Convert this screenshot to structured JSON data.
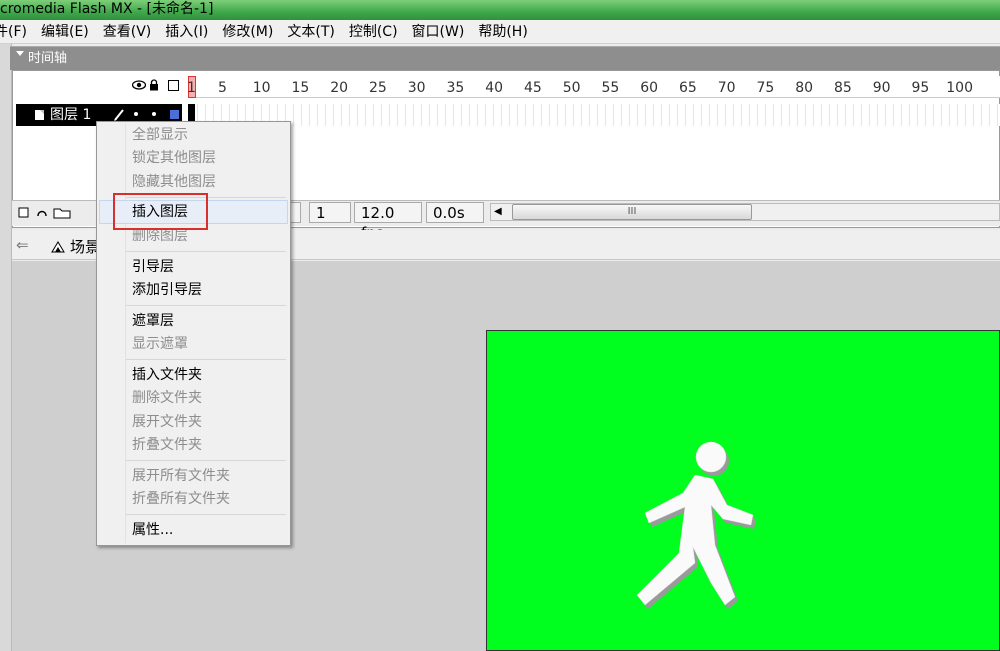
{
  "window": {
    "title": "cromedia Flash MX - [未命名-1]"
  },
  "menubar": [
    "件(F)",
    "编辑(E)",
    "查看(V)",
    "插入(I)",
    "修改(M)",
    "文本(T)",
    "控制(C)",
    "窗口(W)",
    "帮助(H)"
  ],
  "timeline": {
    "title": "时间轴",
    "ruler_ticks": [
      "1",
      "5",
      "10",
      "15",
      "20",
      "25",
      "30",
      "35",
      "40",
      "45",
      "50",
      "55",
      "60",
      "65",
      "70",
      "75",
      "80",
      "85",
      "90",
      "95",
      "100"
    ],
    "layer_name": "图层 1",
    "current_frame": "1",
    "frame_rate": "12.0 fps",
    "elapsed_time": "0.0s",
    "scroll_grip": "III"
  },
  "scene": {
    "label": "场景"
  },
  "context_menu": {
    "items": [
      {
        "label": "全部显示",
        "enabled": false
      },
      {
        "label": "锁定其他图层",
        "enabled": false
      },
      {
        "label": "隐藏其他图层",
        "enabled": false
      },
      {
        "label": "插入图层",
        "enabled": true
      },
      {
        "label": "删除图层",
        "enabled": false
      },
      {
        "label": "引导层",
        "enabled": true
      },
      {
        "label": "添加引导层",
        "enabled": true
      },
      {
        "label": "遮罩层",
        "enabled": true
      },
      {
        "label": "显示遮罩",
        "enabled": false
      },
      {
        "label": "插入文件夹",
        "enabled": true
      },
      {
        "label": "删除文件夹",
        "enabled": false
      },
      {
        "label": "展开文件夹",
        "enabled": false
      },
      {
        "label": "折叠文件夹",
        "enabled": false
      },
      {
        "label": "展开所有文件夹",
        "enabled": false
      },
      {
        "label": "折叠所有文件夹",
        "enabled": false
      },
      {
        "label": "属性...",
        "enabled": true
      }
    ]
  },
  "colors": {
    "stage_bg": "#00ff1e",
    "highlight_box": "#d9302e",
    "layer_color": "#4b6fd6"
  }
}
